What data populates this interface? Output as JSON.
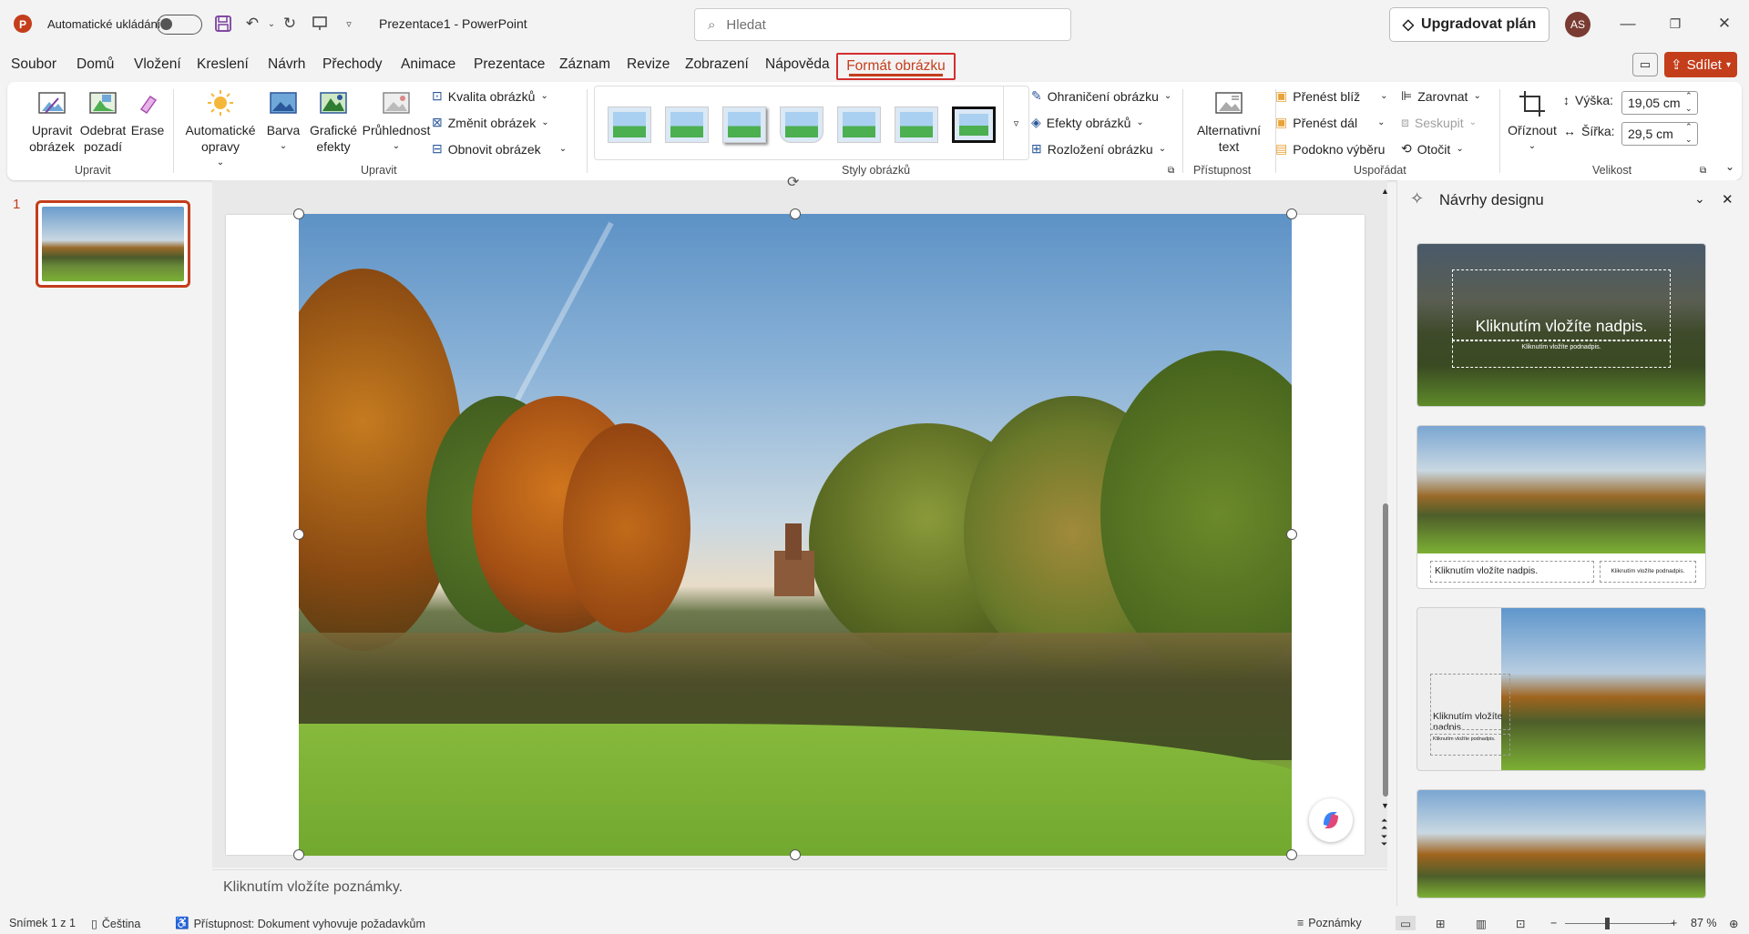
{
  "titlebar": {
    "autosave_label": "Automatické ukládání",
    "document_title": "Prezentace1  -  PowerPoint",
    "search_placeholder": "Hledat",
    "upgrade_label": "Upgradovat plán",
    "avatar_initials": "AS",
    "autosave_on": false
  },
  "menu": {
    "items": [
      "Soubor",
      "Domů",
      "Vložení",
      "Kreslení",
      "Návrh",
      "Přechody",
      "Animace",
      "Prezentace",
      "Záznam",
      "Revize",
      "Zobrazení",
      "Nápověda"
    ],
    "active_tab": "Formát obrázku",
    "share_label": "Sdílet"
  },
  "ribbon": {
    "adjust_group1": {
      "edit_picture": "Upravit obrázek",
      "remove_background": "Odebrat pozadí",
      "erase": "Erase",
      "group_label": "Upravit"
    },
    "adjust_group2": {
      "corrections": "Automatické opravy",
      "color": "Barva",
      "artistic_effects": "Grafické efekty",
      "transparency": "Průhlednost",
      "compress": "Kvalita obrázků",
      "change_picture": "Změnit obrázek",
      "reset_picture": "Obnovit obrázek",
      "group_label": "Upravit"
    },
    "styles": {
      "group_label": "Styly obrázků",
      "border": "Ohraničení obrázku",
      "effects": "Efekty obrázků",
      "layout": "Rozložení obrázku"
    },
    "accessibility": {
      "alt_text": "Alternativní text",
      "group_label": "Přístupnost"
    },
    "arrange": {
      "bring_forward": "Přenést blíž",
      "send_backward": "Přenést dál",
      "selection_pane": "Podokno výběru",
      "align": "Zarovnat",
      "group": "Seskupit",
      "rotate": "Otočit",
      "group_label": "Uspořádat"
    },
    "size": {
      "crop": "Oříznout",
      "height_label": "Výška:",
      "height_value": "19,05 cm",
      "width_label": "Šířka:",
      "width_value": "29,5 cm",
      "group_label": "Velikost"
    }
  },
  "slides_pane": {
    "slide_number": "1"
  },
  "notes": {
    "placeholder": "Kliknutím vložíte poznámky."
  },
  "design_pane": {
    "title": "Návrhy designu",
    "card1_title": "Kliknutím vložíte nadpis.",
    "card1_subtitle": "Kliknutím vložíte podnadpis.",
    "card2_title": "Kliknutím vložíte nadpis.",
    "card2_subtitle": "Kliknutím vložíte podnadpis.",
    "card3_title": "Kliknutím vložíte nadpis.",
    "card3_subtitle": "Kliknutím vložíte podnadpis."
  },
  "statusbar": {
    "slide_info": "Snímek 1 z 1",
    "language": "Čeština",
    "accessibility": "Přístupnost: Dokument vyhovuje požadavkům",
    "notes_label": "Poznámky",
    "zoom": "87 %"
  },
  "colors": {
    "accent": "#c43e1c",
    "highlight_box": "#d32f2f"
  }
}
